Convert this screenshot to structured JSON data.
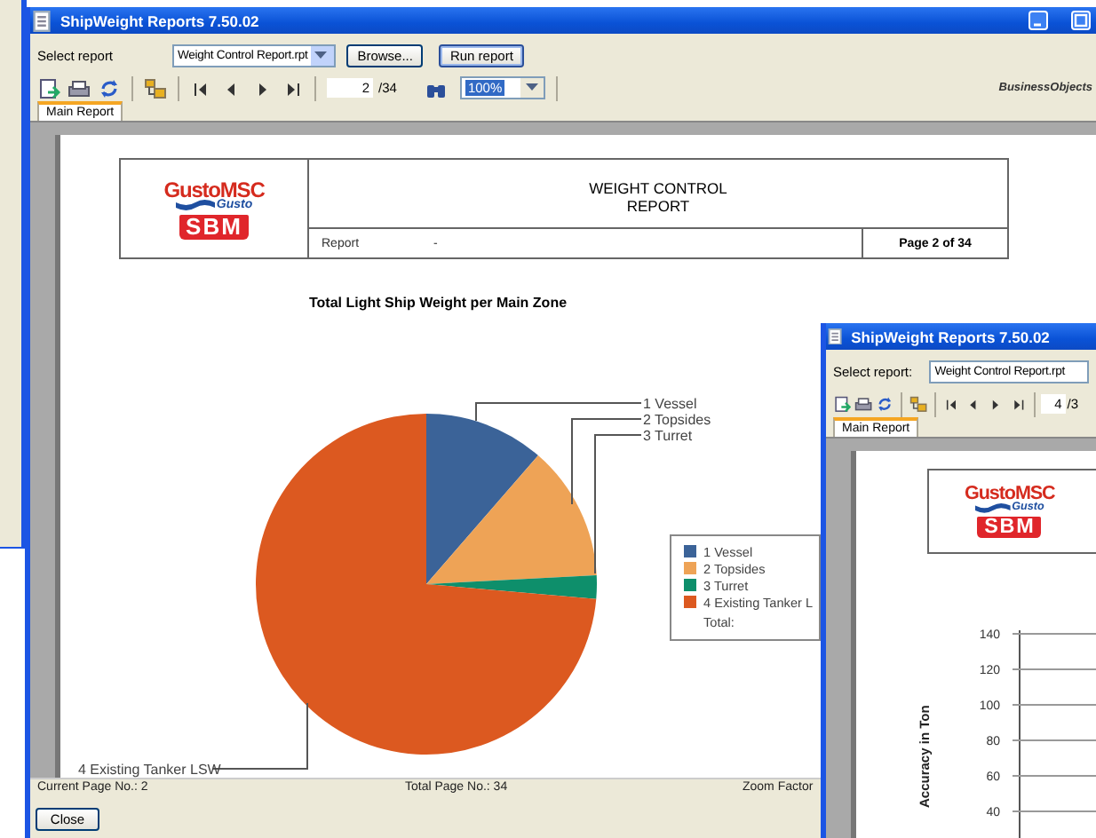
{
  "main_window": {
    "kind": "pie_report",
    "title": "ShipWeight Reports 7.50.02",
    "window_controls": [
      {
        "kind": "minimize"
      },
      {
        "kind": "maximize"
      }
    ],
    "select_label": "Select report",
    "report_file": "Weight Control Report.rpt",
    "buttons": [
      "Browse...",
      "Run report"
    ],
    "page_number": "2",
    "page_total": "/34",
    "zoom": "100%",
    "brand": "BusinessObjects",
    "tabs": [
      {
        "label": "Main Report",
        "selected": true
      }
    ],
    "report": {
      "logo": {
        "name": "GustoMSC",
        "sub": "Gusto",
        "mark": "SBM"
      },
      "heading": [
        "WEIGHT CONTROL",
        "REPORT"
      ],
      "report_label": "Report",
      "report_value": "-",
      "page_label": "Page 2 of 34",
      "chart_title": "Total Light Ship Weight per Main Zone",
      "slices": [
        {
          "callout": "1 Vessel",
          "legend": "1 Vessel",
          "color": "#3b6398"
        },
        {
          "callout": "2 Topsides",
          "legend": "2 Topsides",
          "color": "#eea356"
        },
        {
          "callout": "3 Turret",
          "legend": "3 Turret",
          "color": "#0e8f6b"
        },
        {
          "callout": "4 Existing Tanker LSW",
          "legend": "4 Existing Tanker L",
          "color": "#dc5920"
        }
      ],
      "legend_total": "Total:"
    },
    "status": [
      "Current Page No.: 2",
      "Total Page No.: 34",
      "Zoom Factor"
    ],
    "close": "Close"
  },
  "second_window": {
    "kind": "axis_report",
    "title": "ShipWeight Reports 7.50.02",
    "select_label": "Select report:",
    "report_file": "Weight Control Report.rpt",
    "page_number": "4",
    "page_total": "/3",
    "tabs": [
      {
        "label": "Main Report",
        "selected": true
      }
    ],
    "report": {
      "logo": {
        "name": "GustoMSC",
        "sub": "Gusto",
        "mark": "SBM"
      },
      "axis_title": "Accuracy in Ton",
      "yticks": [
        "140",
        "120",
        "100",
        "80",
        "60",
        "40"
      ]
    }
  }
}
